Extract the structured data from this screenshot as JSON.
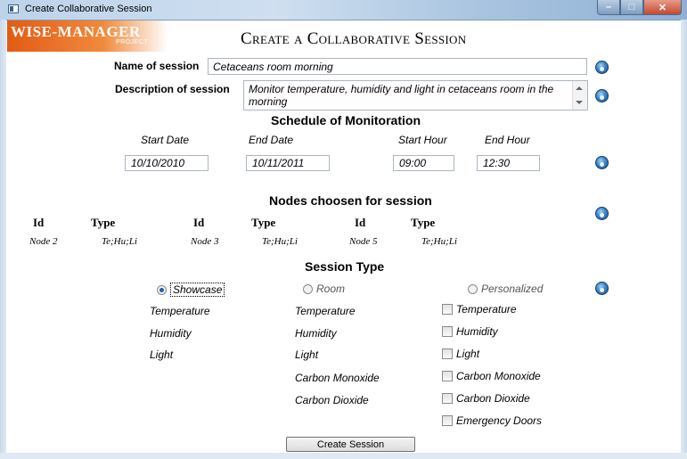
{
  "window": {
    "title": "Create Collaborative Session"
  },
  "logo": {
    "main": "WISE-MANAGER",
    "sub": "PROJECT"
  },
  "header": {
    "title": "Create a Collaborative Session"
  },
  "session": {
    "name_label": "Name of session",
    "name_value": "Cetaceans room morning",
    "description_label": "Description of session",
    "description_value": "Monitor temperature, humidity and light in cetaceans room in the morning"
  },
  "schedule": {
    "title": "Schedule of Monitoration",
    "start_date_label": "Start Date",
    "start_date": "10/10/2010",
    "end_date_label": "End Date",
    "end_date": "10/11/2011",
    "start_hour_label": "Start Hour",
    "start_hour": "09:00",
    "end_hour_label": "End Hour",
    "end_hour": "12:30"
  },
  "nodes": {
    "title": "Nodes choosen for session",
    "id_header": "Id",
    "type_header": "Type",
    "items": [
      {
        "id": "Node 2",
        "type": "Te;Hu;Li"
      },
      {
        "id": "Node 3",
        "type": "Te;Hu;Li"
      },
      {
        "id": "Node 5",
        "type": "Te;Hu;Li"
      }
    ]
  },
  "session_type": {
    "title": "Session Type",
    "options": [
      {
        "label": "Showcase",
        "selected": true
      },
      {
        "label": "Room",
        "selected": false
      },
      {
        "label": "Personalized",
        "selected": false
      }
    ],
    "showcase_sensors": [
      "Temperature",
      "Humidity",
      "Light"
    ],
    "room_sensors": [
      "Temperature",
      "Humidity",
      "Light",
      "Carbon Monoxide",
      "Carbon Dioxide"
    ],
    "personalized_sensors": [
      "Temperature",
      "Humidity",
      "Light",
      "Carbon Monoxide",
      "Carbon Dioxide",
      "Emergency Doors"
    ]
  },
  "actions": {
    "create_label": "Create Session"
  }
}
